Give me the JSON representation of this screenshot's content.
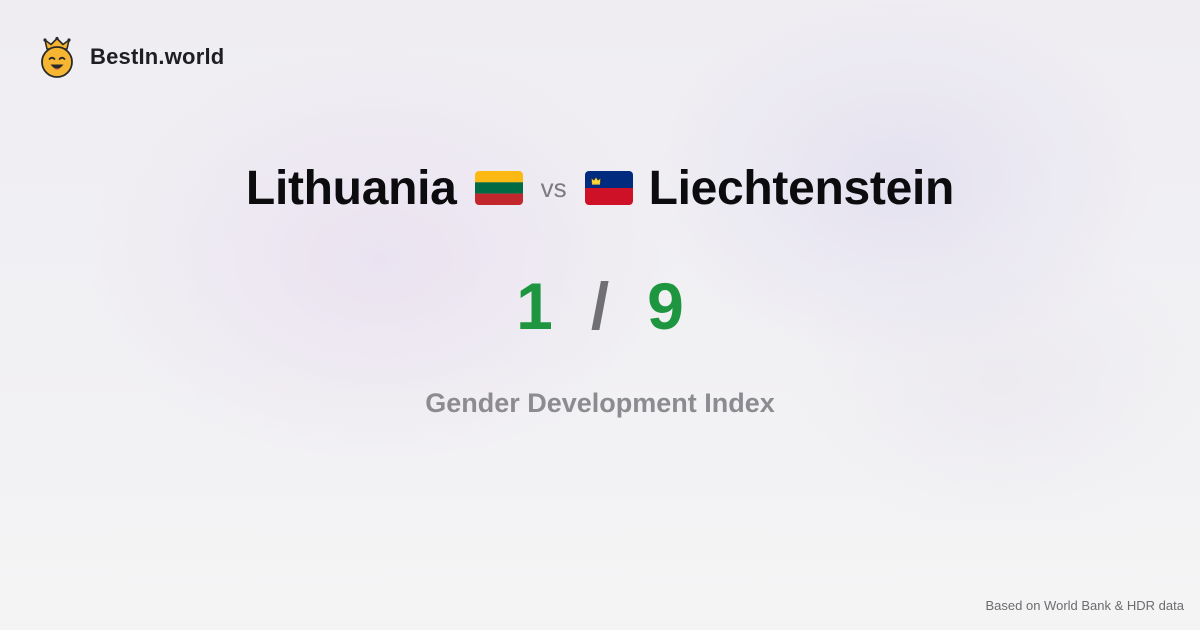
{
  "brand": {
    "name": "BestIn.world",
    "logo_icon": "crown-smiley-icon"
  },
  "comparison": {
    "left_country": "Lithuania",
    "left_flag_icon": "lithuania-flag-icon",
    "vs_label": "vs",
    "right_country": "Liechtenstein",
    "right_flag_icon": "liechtenstein-flag-icon"
  },
  "scores": {
    "left_rank": "1",
    "separator": "/",
    "right_rank": "9"
  },
  "metric": {
    "label": "Gender Development Index"
  },
  "footer": {
    "source": "Based on World Bank & HDR data"
  },
  "colors": {
    "rank_green": "#1e9640",
    "title_dark": "#0c0c0e",
    "muted_gray": "#8c8c90",
    "lithuania_flag": [
      "#fdb913",
      "#006a44",
      "#c1272d"
    ],
    "liechtenstein_flag": [
      "#002b7f",
      "#ce1126"
    ]
  }
}
